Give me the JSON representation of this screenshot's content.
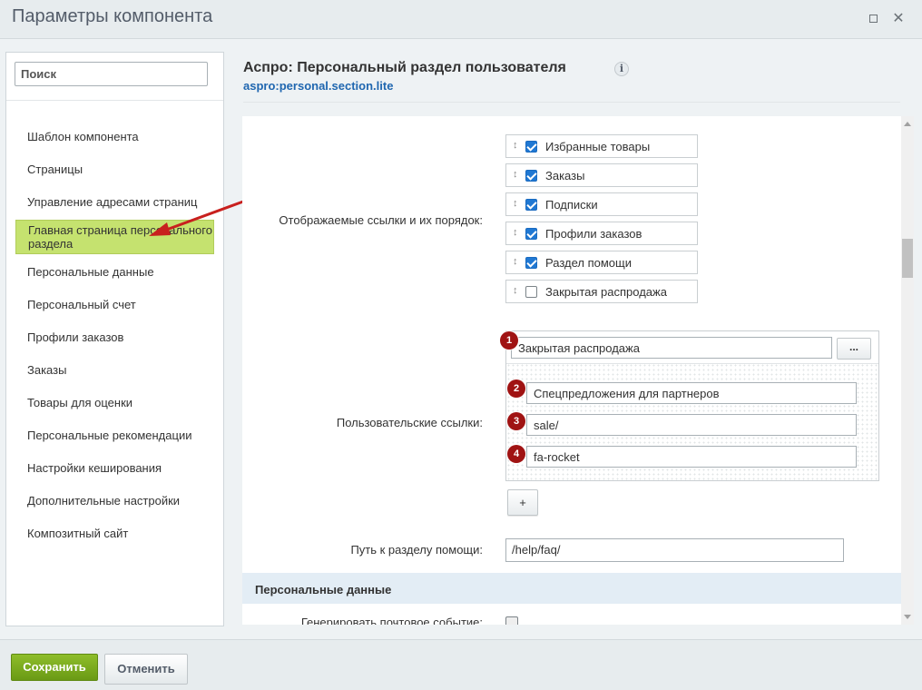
{
  "window": {
    "title": "Параметры компонента",
    "maximize_icon": "maximize-icon",
    "close_glyph": "✕"
  },
  "sidebar": {
    "search_placeholder": "Поиск",
    "items": [
      {
        "label": "Шаблон компонента"
      },
      {
        "label": "Страницы"
      },
      {
        "label": "Управление адресами страниц"
      },
      {
        "label": "Главная страница персонального раздела",
        "active": true
      },
      {
        "label": "Персональные данные"
      },
      {
        "label": "Персональный счет"
      },
      {
        "label": "Профили заказов"
      },
      {
        "label": "Заказы"
      },
      {
        "label": "Товары для оценки"
      },
      {
        "label": "Персональные рекомендации"
      },
      {
        "label": "Настройки кеширования"
      },
      {
        "label": "Дополнительные настройки"
      },
      {
        "label": "Композитный сайт"
      }
    ],
    "active_color": "#c5e26f"
  },
  "main": {
    "title": "Аспро: Персональный раздел пользователя",
    "info_glyph": "i",
    "code": "aspro:personal.section.lite",
    "links_label": "Отображаемые ссылки и их порядок:",
    "links": [
      {
        "label": "Избранные товары",
        "checked": true
      },
      {
        "label": "Заказы",
        "checked": true
      },
      {
        "label": "Подписки",
        "checked": true
      },
      {
        "label": "Профили заказов",
        "checked": true
      },
      {
        "label": "Раздел помощи",
        "checked": true
      },
      {
        "label": "Закрытая распродажа",
        "checked": false
      }
    ],
    "drag_glyph": "↕",
    "custom_label": "Пользовательские ссылки:",
    "custom_fields": [
      {
        "badge": "1",
        "value": "Закрытая распродажа"
      },
      {
        "badge": "2",
        "value": "Спецпредложения для партнеров"
      },
      {
        "badge": "3",
        "value": "sale/"
      },
      {
        "badge": "4",
        "value": "fa-rocket"
      }
    ],
    "dots_label": "...",
    "plus_label": "+",
    "help_label": "Путь к разделу помощи:",
    "help_value": "/help/faq/",
    "section_personal": "Персональные данные",
    "mail_label": "Генерировать почтовое событие:"
  },
  "footer": {
    "save_label": "Сохранить",
    "cancel_label": "Отменить"
  },
  "colors": {
    "accent_green": "#7aab1e",
    "link_blue": "#2067b0",
    "badge_red": "#a01313",
    "checkbox_blue": "#2078d3"
  }
}
